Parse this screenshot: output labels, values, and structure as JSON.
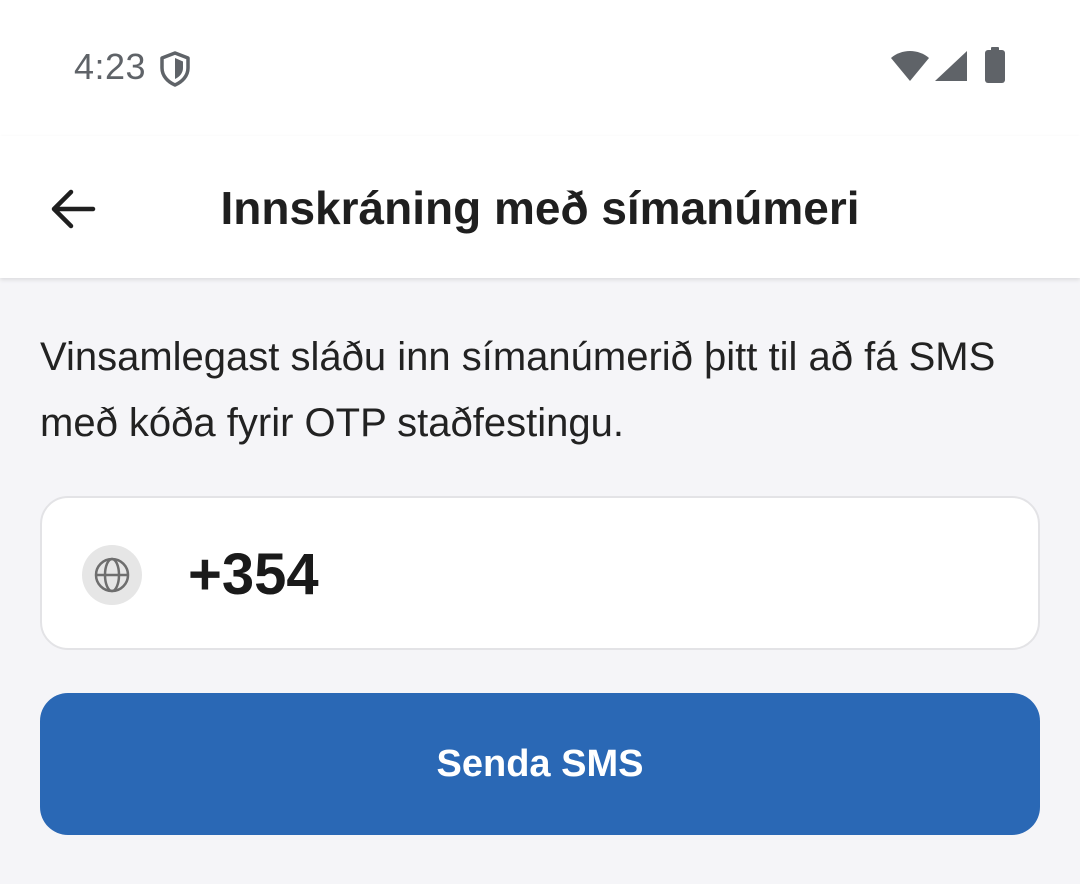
{
  "status_bar": {
    "time": "4:23",
    "icons": [
      "shield-icon",
      "wifi-icon",
      "signal-icon",
      "battery-icon"
    ]
  },
  "app_bar": {
    "back_icon": "arrow-back-icon",
    "title": "Innskráning með símanúmeri"
  },
  "content": {
    "instructions": "Vinsamlegast sláðu inn símanúmerið þitt til að fá SMS með kóða fyrir OTP staðfestingu.",
    "phone_field": {
      "country_icon": "globe-icon",
      "value": "+354"
    },
    "send_button_label": "Senda SMS"
  },
  "colors": {
    "primary": "#2a68b5",
    "background": "#f5f5f8",
    "surface": "#ffffff",
    "text": "#1f1f1f",
    "status_text": "#5f6368"
  }
}
